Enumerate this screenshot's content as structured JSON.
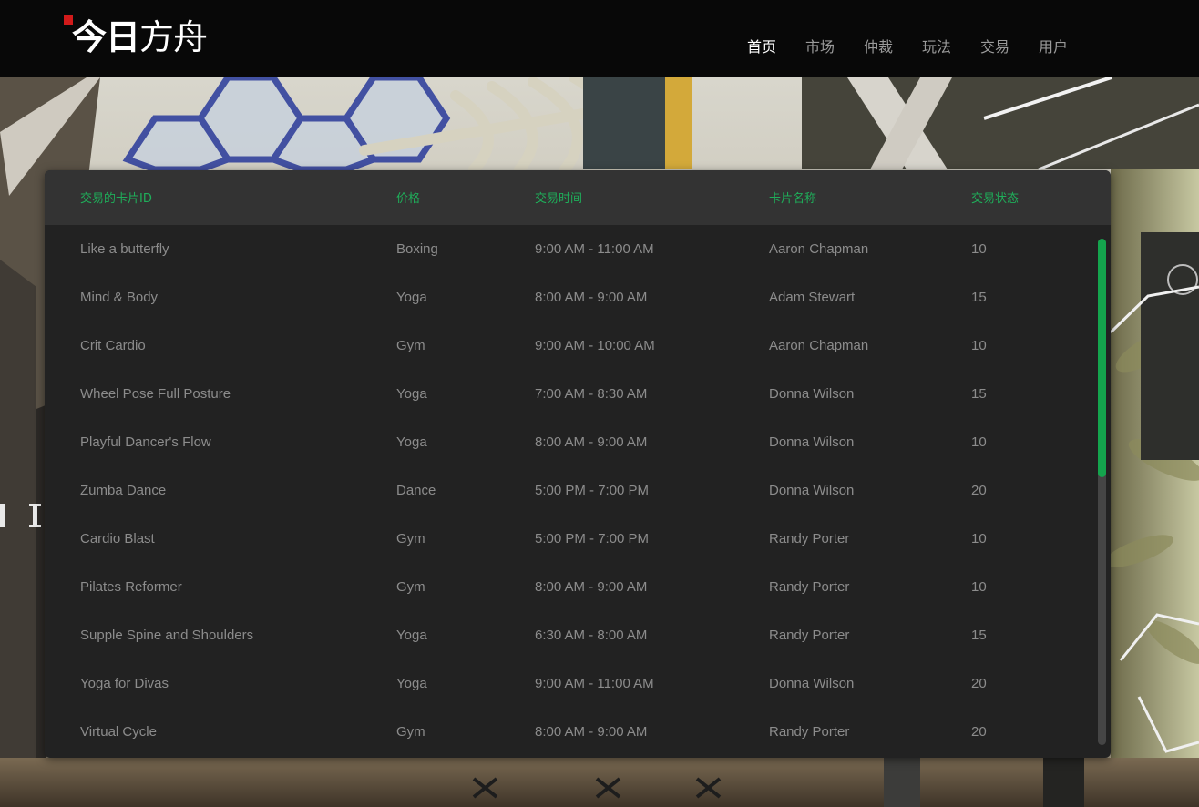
{
  "logo": {
    "bold": "今日",
    "rest": "方舟"
  },
  "nav": [
    {
      "label": "首页",
      "active": true
    },
    {
      "label": "市场",
      "active": false
    },
    {
      "label": "仲裁",
      "active": false
    },
    {
      "label": "玩法",
      "active": false
    },
    {
      "label": "交易",
      "active": false
    },
    {
      "label": "用户",
      "active": false
    }
  ],
  "table": {
    "headers": [
      "交易的卡片ID",
      "价格",
      "交易时间",
      "卡片名称",
      "交易状态"
    ],
    "rows": [
      [
        "Like a butterfly",
        "Boxing",
        "9:00 AM - 11:00 AM",
        "Aaron Chapman",
        "10"
      ],
      [
        "Mind & Body",
        "Yoga",
        "8:00 AM - 9:00 AM",
        "Adam Stewart",
        "15"
      ],
      [
        "Crit Cardio",
        "Gym",
        "9:00 AM - 10:00 AM",
        "Aaron Chapman",
        "10"
      ],
      [
        "Wheel Pose Full Posture",
        "Yoga",
        "7:00 AM - 8:30 AM",
        "Donna Wilson",
        "15"
      ],
      [
        "Playful Dancer's Flow",
        "Yoga",
        "8:00 AM - 9:00 AM",
        "Donna Wilson",
        "10"
      ],
      [
        "Zumba Dance",
        "Dance",
        "5:00 PM - 7:00 PM",
        "Donna Wilson",
        "20"
      ],
      [
        "Cardio Blast",
        "Gym",
        "5:00 PM - 7:00 PM",
        "Randy Porter",
        "10"
      ],
      [
        "Pilates Reformer",
        "Gym",
        "8:00 AM - 9:00 AM",
        "Randy Porter",
        "10"
      ],
      [
        "Supple Spine and Shoulders",
        "Yoga",
        "6:30 AM - 8:00 AM",
        "Randy Porter",
        "15"
      ],
      [
        "Yoga for Divas",
        "Yoga",
        "9:00 AM - 11:00 AM",
        "Donna Wilson",
        "20"
      ],
      [
        "Virtual Cycle",
        "Gym",
        "8:00 AM - 9:00 AM",
        "Randy Porter",
        "20"
      ]
    ]
  },
  "colors": {
    "accent": "#1fae5a",
    "logo_mark": "#d11a1a",
    "panel_bg": "#222222",
    "header_bg": "#333333"
  }
}
